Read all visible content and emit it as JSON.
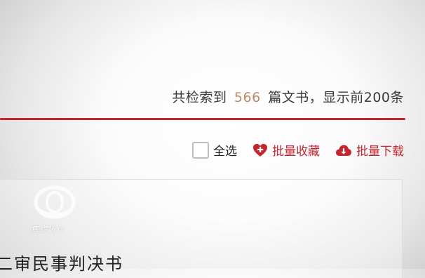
{
  "result_summary": {
    "prefix": "共检索到",
    "count": "566",
    "suffix": "篇文书，显示前200条"
  },
  "actions": {
    "select_all": "全选",
    "batch_favorite": "批量收藏",
    "batch_download": "批量下载"
  },
  "watermark": {
    "text": "焦点访谈"
  },
  "result_list": {
    "first_title": "二审民事判决书"
  },
  "colors": {
    "accent_red": "#c4262e",
    "count_color": "#b88a6a"
  }
}
